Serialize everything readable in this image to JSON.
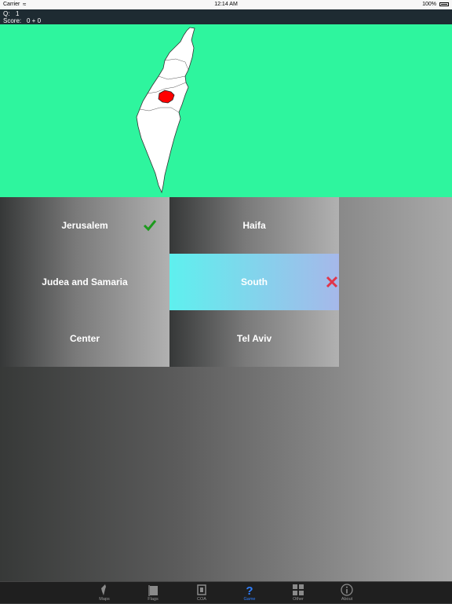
{
  "status_bar": {
    "carrier": "Carrier",
    "time": "12:14 AM",
    "battery": "100%"
  },
  "info": {
    "q_label": "Q:",
    "q_value": "1",
    "score_label": "Score:",
    "score_value": "0 + 0"
  },
  "map": {
    "region_fill": "#ff0000",
    "background": "#2ef59e",
    "highlighted_region": "Jerusalem"
  },
  "answers": [
    {
      "label": "Jerusalem",
      "mark": "check-icon"
    },
    {
      "label": "Haifa",
      "mark": ""
    },
    {
      "label": "Judea and Samaria",
      "mark": ""
    },
    {
      "label": "South",
      "mark": "cross-icon",
      "selected": true
    },
    {
      "label": "Center",
      "mark": ""
    },
    {
      "label": "Tel Aviv",
      "mark": ""
    }
  ],
  "tabs": [
    {
      "label": "Maps",
      "icon": "map-icon"
    },
    {
      "label": "Flags",
      "icon": "flag-icon"
    },
    {
      "label": "COA",
      "icon": "coat-of-arms-icon"
    },
    {
      "label": "Game",
      "icon": "question-icon",
      "active": true
    },
    {
      "label": "Other",
      "icon": "grid-icon"
    },
    {
      "label": "About",
      "icon": "info-icon"
    }
  ]
}
